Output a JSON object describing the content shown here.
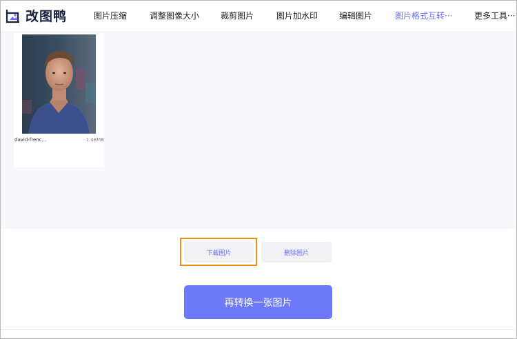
{
  "app": {
    "title": "改图鸭"
  },
  "nav": {
    "items": [
      {
        "label": "图片压缩"
      },
      {
        "label": "调整图像大小"
      },
      {
        "label": "裁剪图片"
      },
      {
        "label": "图片加水印"
      },
      {
        "label": "编辑图片"
      },
      {
        "label": "图片格式互转···",
        "active": true
      },
      {
        "label": "更多工具···"
      }
    ]
  },
  "file": {
    "name": "david-frenc...",
    "size": "1.48MB"
  },
  "actions": {
    "download_label": "下载图片",
    "delete_label": "删除图片",
    "convert_again_label": "再转换一张图片"
  },
  "colors": {
    "accent": "#6b6ef9",
    "primary_button": "#6d79f9",
    "focus": "#f08c1a"
  }
}
